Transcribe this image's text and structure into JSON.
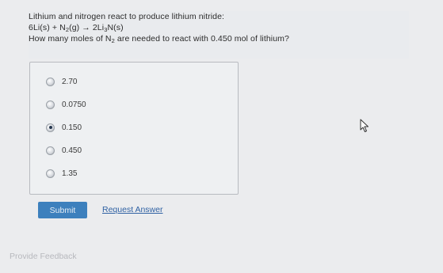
{
  "question": {
    "line1": "Lithium and nitrogen react to produce lithium nitride:",
    "equation": {
      "reactant1": "6Li(s) + N",
      "reactant2_sub": "2",
      "reactant2_rest": "(g) → 2Li",
      "product_sub": "3",
      "product_rest": "N(s)"
    },
    "prompt": {
      "before": "How many moles of N",
      "sub": "2",
      "after": " are needed to react with 0.450 mol of lithium?"
    }
  },
  "choices": [
    {
      "label": "2.70",
      "selected": false
    },
    {
      "label": "0.0750",
      "selected": false
    },
    {
      "label": "0.150",
      "selected": true
    },
    {
      "label": "0.450",
      "selected": false
    },
    {
      "label": "1.35",
      "selected": false
    }
  ],
  "actions": {
    "submit_label": "Submit",
    "request_answer_label": "Request Answer"
  },
  "footer": {
    "feedback_label": "Provide Feedback"
  },
  "colors": {
    "accent": "#3d80bd",
    "link": "#2f61a3"
  }
}
